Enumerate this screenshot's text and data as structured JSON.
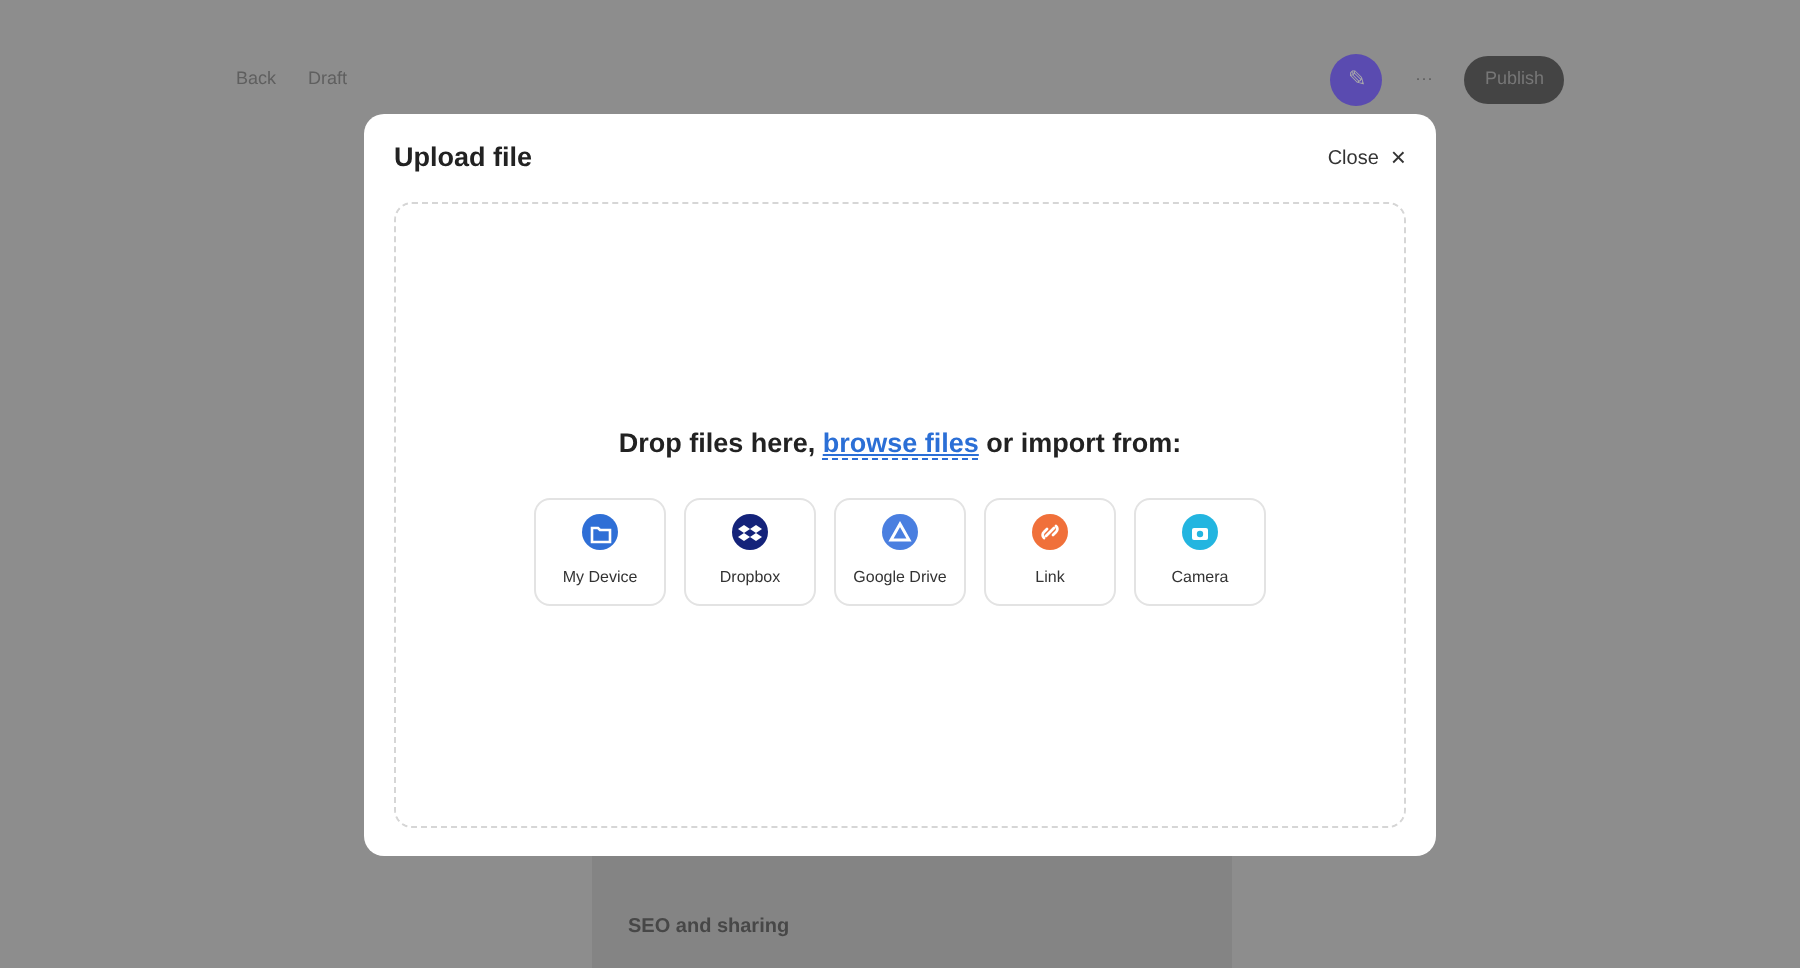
{
  "background": {
    "back": "Back",
    "draft": "Draft",
    "avatar": "✎",
    "more": "···",
    "publish": "Publish",
    "section": "SEO and sharing"
  },
  "modal": {
    "title": "Upload file",
    "close": "Close",
    "close_glyph": "×",
    "prompt": {
      "before": "Drop files here,",
      "link": "browse files",
      "after": "or import from:"
    },
    "sources": [
      {
        "kind": "device",
        "label": "My Device",
        "color": "#2f6fd6"
      },
      {
        "kind": "dropbox",
        "label": "Dropbox",
        "color": "#14237a"
      },
      {
        "kind": "drive",
        "label": "Google Drive",
        "color": "#4a7fe0"
      },
      {
        "kind": "link",
        "label": "Link",
        "color": "#f0703a"
      },
      {
        "kind": "camera",
        "label": "Camera",
        "color": "#23b5e0"
      }
    ]
  }
}
